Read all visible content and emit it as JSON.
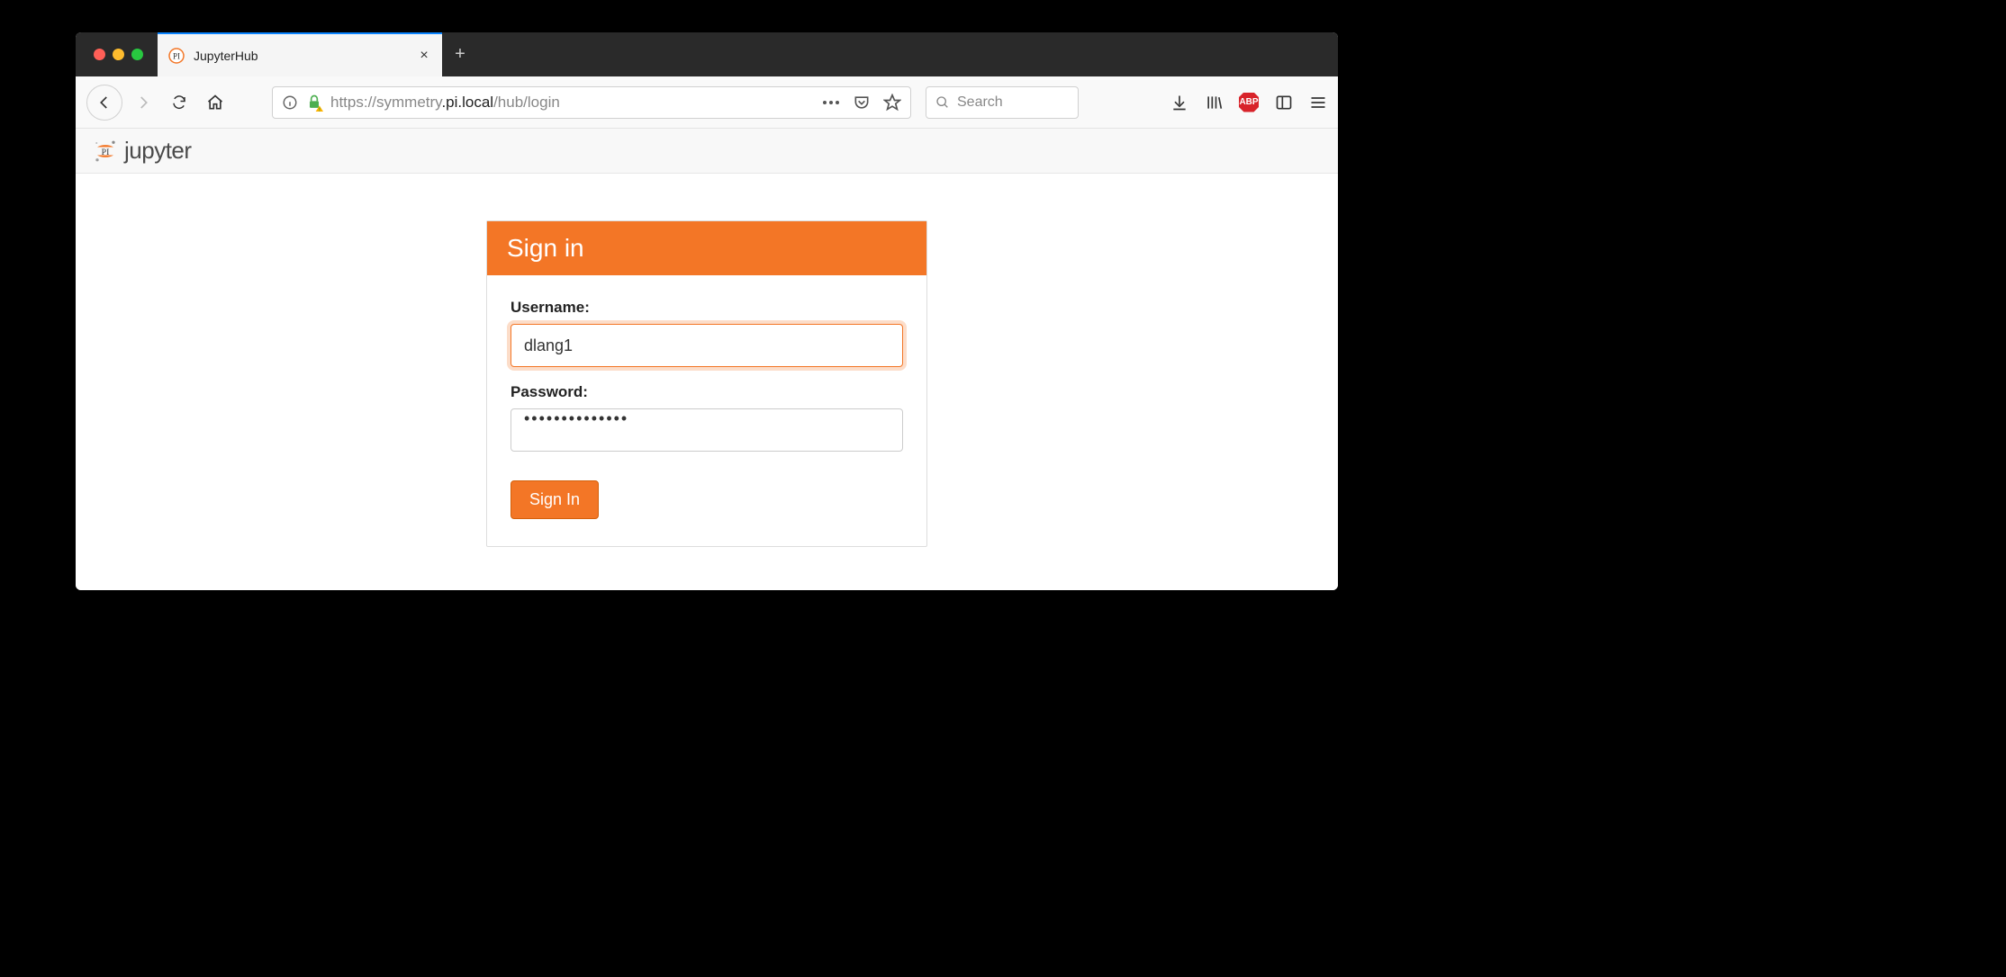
{
  "browser": {
    "tab_title": "JupyterHub",
    "url_prefix": "https://symmetry",
    "url_host_dark": ".pi.local",
    "url_path": "/hub/login",
    "search_placeholder": "Search"
  },
  "page": {
    "logo_text": "jupyter",
    "login": {
      "heading": "Sign in",
      "username_label": "Username:",
      "username_value": "dlang1",
      "password_label": "Password:",
      "password_value": "••••••••••••••",
      "submit_label": "Sign In"
    }
  }
}
